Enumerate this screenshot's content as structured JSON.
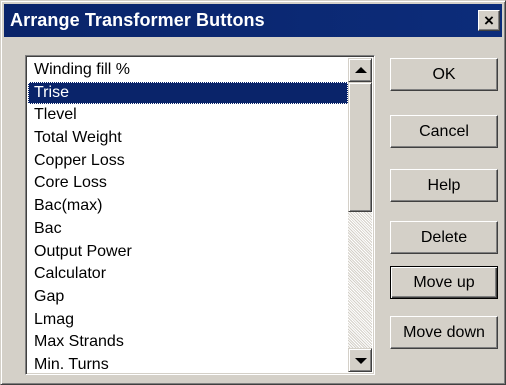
{
  "window": {
    "title": "Arrange Transformer Buttons",
    "close_label": "×"
  },
  "list": {
    "selected_index": 1,
    "items": [
      "Winding fill %",
      "Trise",
      "Tlevel",
      "Total Weight",
      "Copper Loss",
      "Core Loss",
      "Bac(max)",
      "Bac",
      "Output Power",
      "Calculator",
      "Gap",
      "Lmag",
      "Max Strands",
      "Min. Turns"
    ]
  },
  "buttons": {
    "ok": "OK",
    "cancel": "Cancel",
    "help": "Help",
    "delete": "Delete",
    "move_up": "Move up",
    "move_down": "Move down"
  },
  "icons": {
    "close": "close-icon",
    "scroll_up": "scroll-up-arrow-icon",
    "scroll_down": "scroll-down-arrow-icon"
  },
  "colors": {
    "titlebar": "#0a246a",
    "selection": "#0a246a",
    "face": "#d4d0c8"
  }
}
